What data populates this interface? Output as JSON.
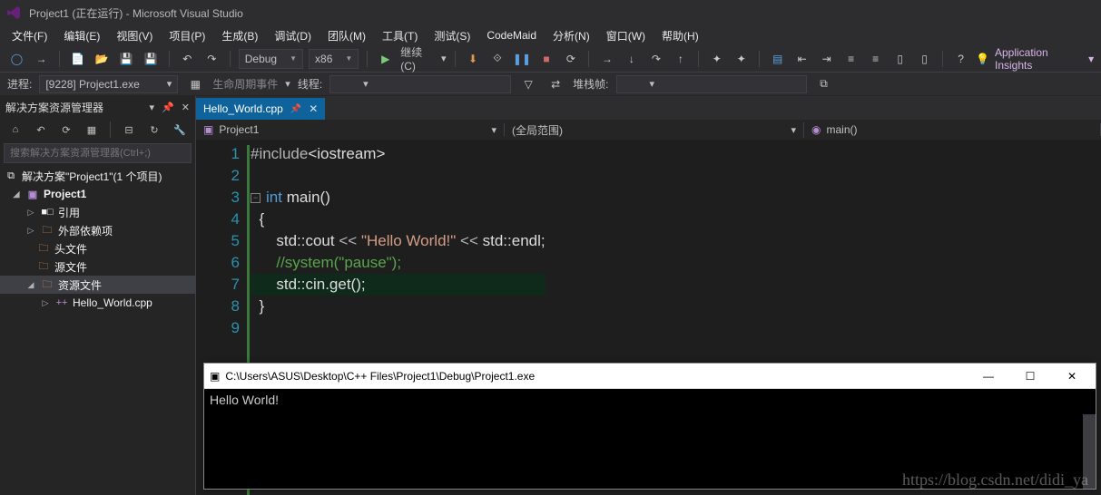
{
  "title": "Project1 (正在运行) - Microsoft Visual Studio",
  "menu": [
    "文件(F)",
    "编辑(E)",
    "视图(V)",
    "项目(P)",
    "生成(B)",
    "调试(D)",
    "团队(M)",
    "工具(T)",
    "测试(S)",
    "CodeMaid",
    "分析(N)",
    "窗口(W)",
    "帮助(H)"
  ],
  "toolbar": {
    "config": "Debug",
    "platform": "x86",
    "continue": "继续(C)",
    "insights": "Application Insights"
  },
  "debugbar": {
    "process_label": "进程:",
    "process_value": "[9228] Project1.exe",
    "lifecycle": "生命周期事件",
    "thread_label": "线程:",
    "stackframe_label": "堆栈帧:"
  },
  "panel": {
    "title": "解决方案资源管理器",
    "search_placeholder": "搜索解决方案资源管理器(Ctrl+;)",
    "solution": "解决方案\"Project1\"(1 个项目)",
    "project": "Project1",
    "refs": "引用",
    "external": "外部依赖项",
    "headers": "头文件",
    "sources": "源文件",
    "resources": "资源文件",
    "file": "Hello_World.cpp"
  },
  "tab": {
    "label": "Hello_World.cpp"
  },
  "nav": {
    "project": "Project1",
    "scope": "(全局范围)",
    "func": "main()"
  },
  "code": {
    "lines": [
      "#include<iostream>",
      "",
      "int main()",
      "{",
      "    std::cout << \"Hello World!\" << std::endl;",
      "    //system(\"pause\");",
      "    std::cin.get();",
      "}",
      ""
    ]
  },
  "console": {
    "title": "C:\\Users\\ASUS\\Desktop\\C++ Files\\Project1\\Debug\\Project1.exe",
    "output": "Hello World!"
  },
  "watermark": "https://blog.csdn.net/didi_ya"
}
